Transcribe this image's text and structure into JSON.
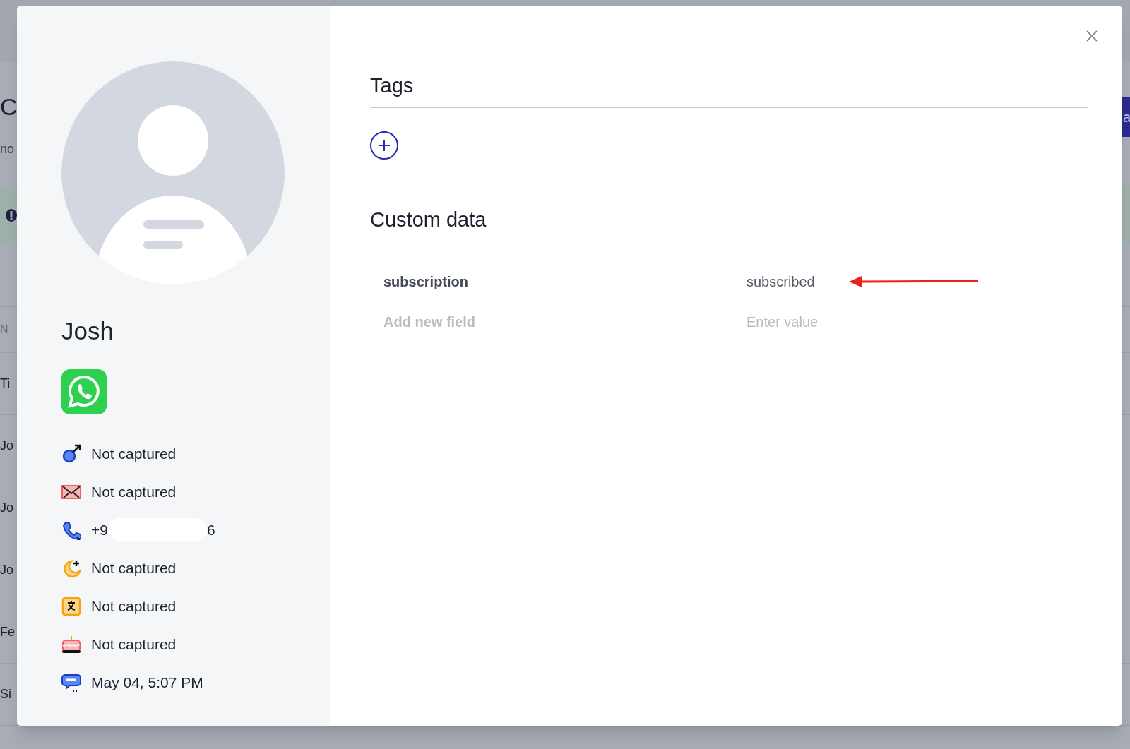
{
  "background": {
    "heading": "C",
    "subheading": "no",
    "column_header": "N",
    "rows": [
      "Ti",
      "Jo",
      "Jo",
      "Jo",
      "Fe",
      "Si"
    ],
    "button_label": "a"
  },
  "profile": {
    "name": "Josh",
    "channel_badge": {
      "kind": "whatsapp"
    },
    "attributes": [
      {
        "kind": "gender",
        "value": "Not captured"
      },
      {
        "kind": "email",
        "value": "Not captured"
      },
      {
        "kind": "phone",
        "prefix": "+9",
        "suffix": "6"
      },
      {
        "kind": "timezone",
        "value": "Not captured"
      },
      {
        "kind": "language",
        "value": "Not captured"
      },
      {
        "kind": "birthday",
        "value": "Not captured"
      },
      {
        "kind": "last_message",
        "value": "May 04, 5:07 PM"
      }
    ]
  },
  "tags": {
    "title": "Tags"
  },
  "custom_data": {
    "title": "Custom data",
    "fields": [
      {
        "name": "subscription",
        "value": "subscribed"
      }
    ],
    "new_field": {
      "placeholder": "Add new field",
      "value_placeholder": "Enter value"
    }
  }
}
